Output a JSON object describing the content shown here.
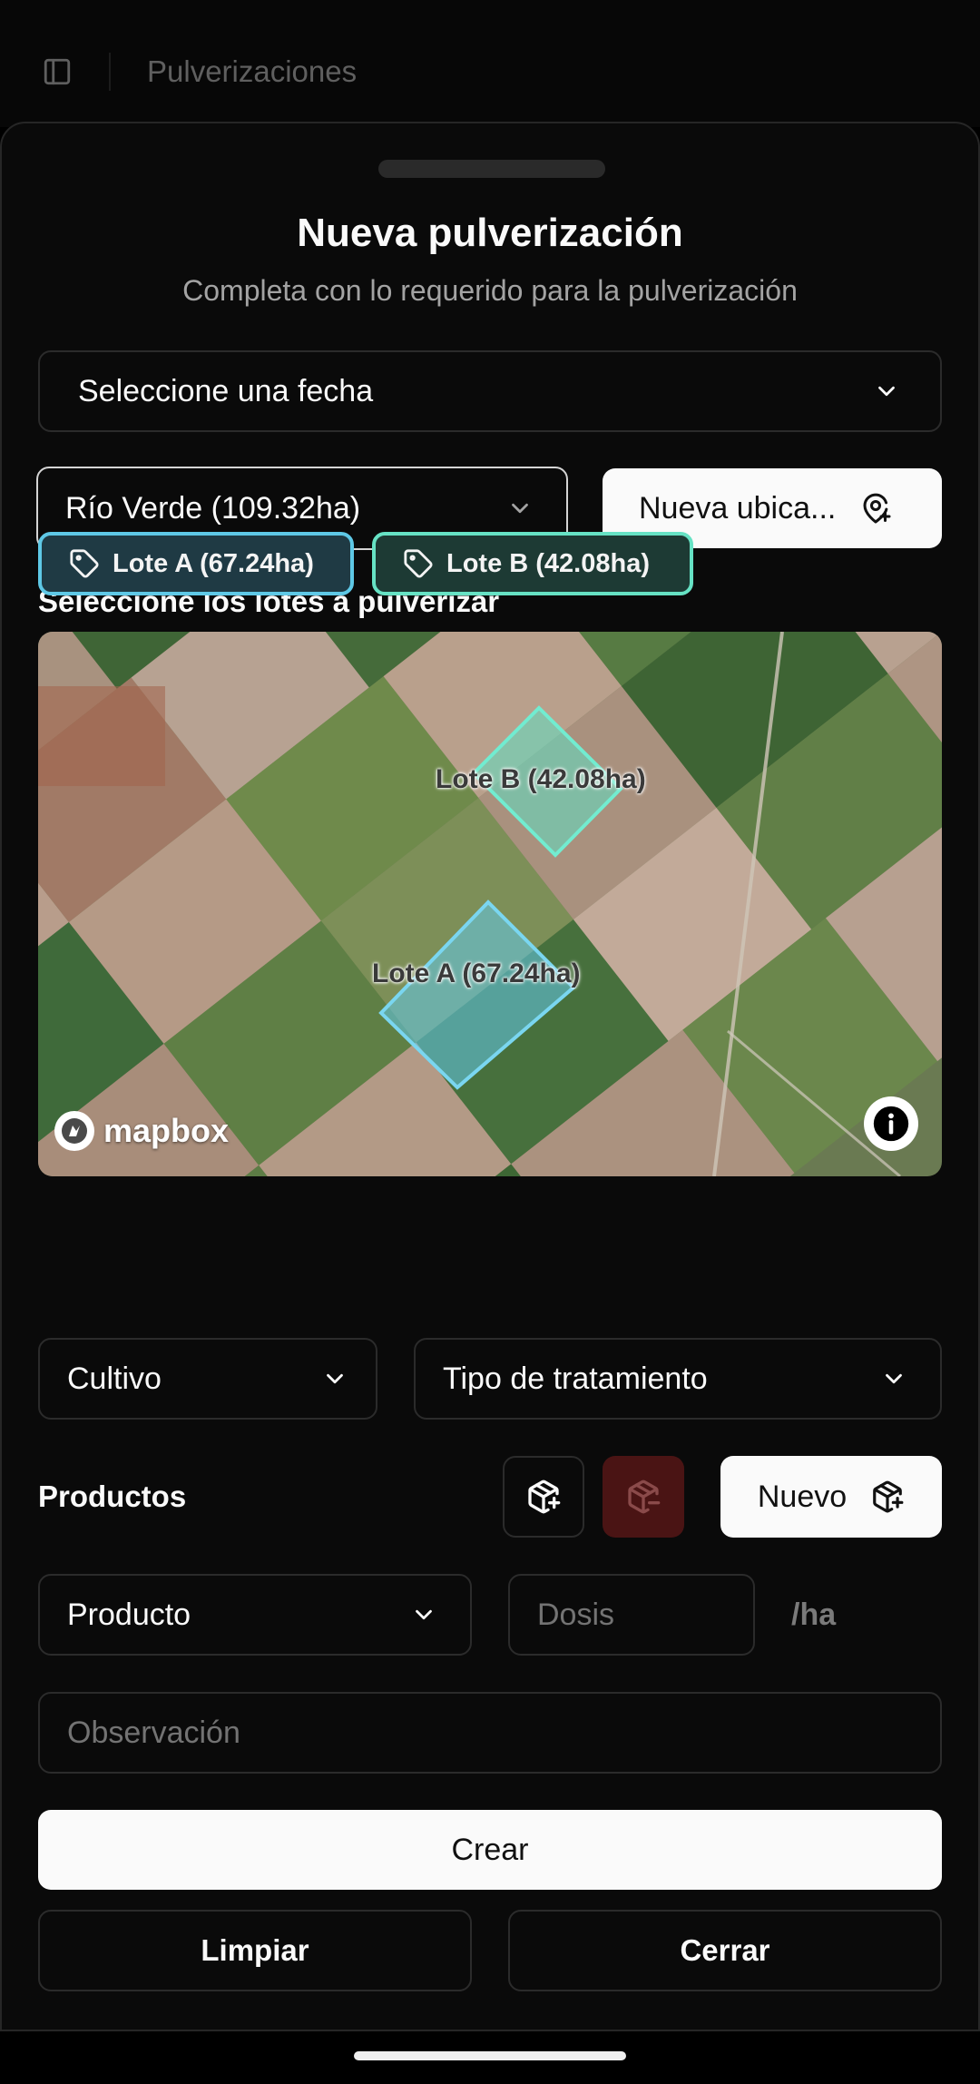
{
  "topbar": {
    "title": "Pulverizaciones",
    "sidebar_icon": "sidebar-toggle-icon"
  },
  "sheet": {
    "title": "Nueva pulverización",
    "subtitle": "Completa con lo requerido para la pulverización"
  },
  "fecha_select": {
    "value": "Seleccione una fecha"
  },
  "ubicacion_select": {
    "value": "Río Verde (109.32ha)"
  },
  "nueva_ubicacion_button": {
    "label": "Nueva ubica...",
    "icon": "map-pin-plus-icon"
  },
  "lotes": {
    "heading": "Seleccione los lotes a pulverizar",
    "items": [
      {
        "label": "Lote A (67.24ha)",
        "color": "#5ec8e6"
      },
      {
        "label": "Lote B (42.08ha)",
        "color": "#66e2c4"
      }
    ]
  },
  "map": {
    "labels": [
      "Lote A (67.24ha)",
      "Lote B (42.08ha)"
    ],
    "attribution": "mapbox",
    "info_icon": "info-icon"
  },
  "cultivo_select": {
    "value": "Cultivo"
  },
  "tratamiento_select": {
    "value": "Tipo de tratamiento"
  },
  "productos": {
    "heading": "Productos",
    "add_icon": "package-plus-icon",
    "remove_icon": "package-minus-icon",
    "remove_color": "#4a1414",
    "nuevo_label": "Nuevo"
  },
  "producto_select": {
    "value": "Producto"
  },
  "dosis_input": {
    "placeholder": "Dosis",
    "suffix": "/ha"
  },
  "observacion_input": {
    "placeholder": "Observación"
  },
  "actions": {
    "crear": "Crear",
    "limpiar": "Limpiar",
    "cerrar": "Cerrar"
  }
}
